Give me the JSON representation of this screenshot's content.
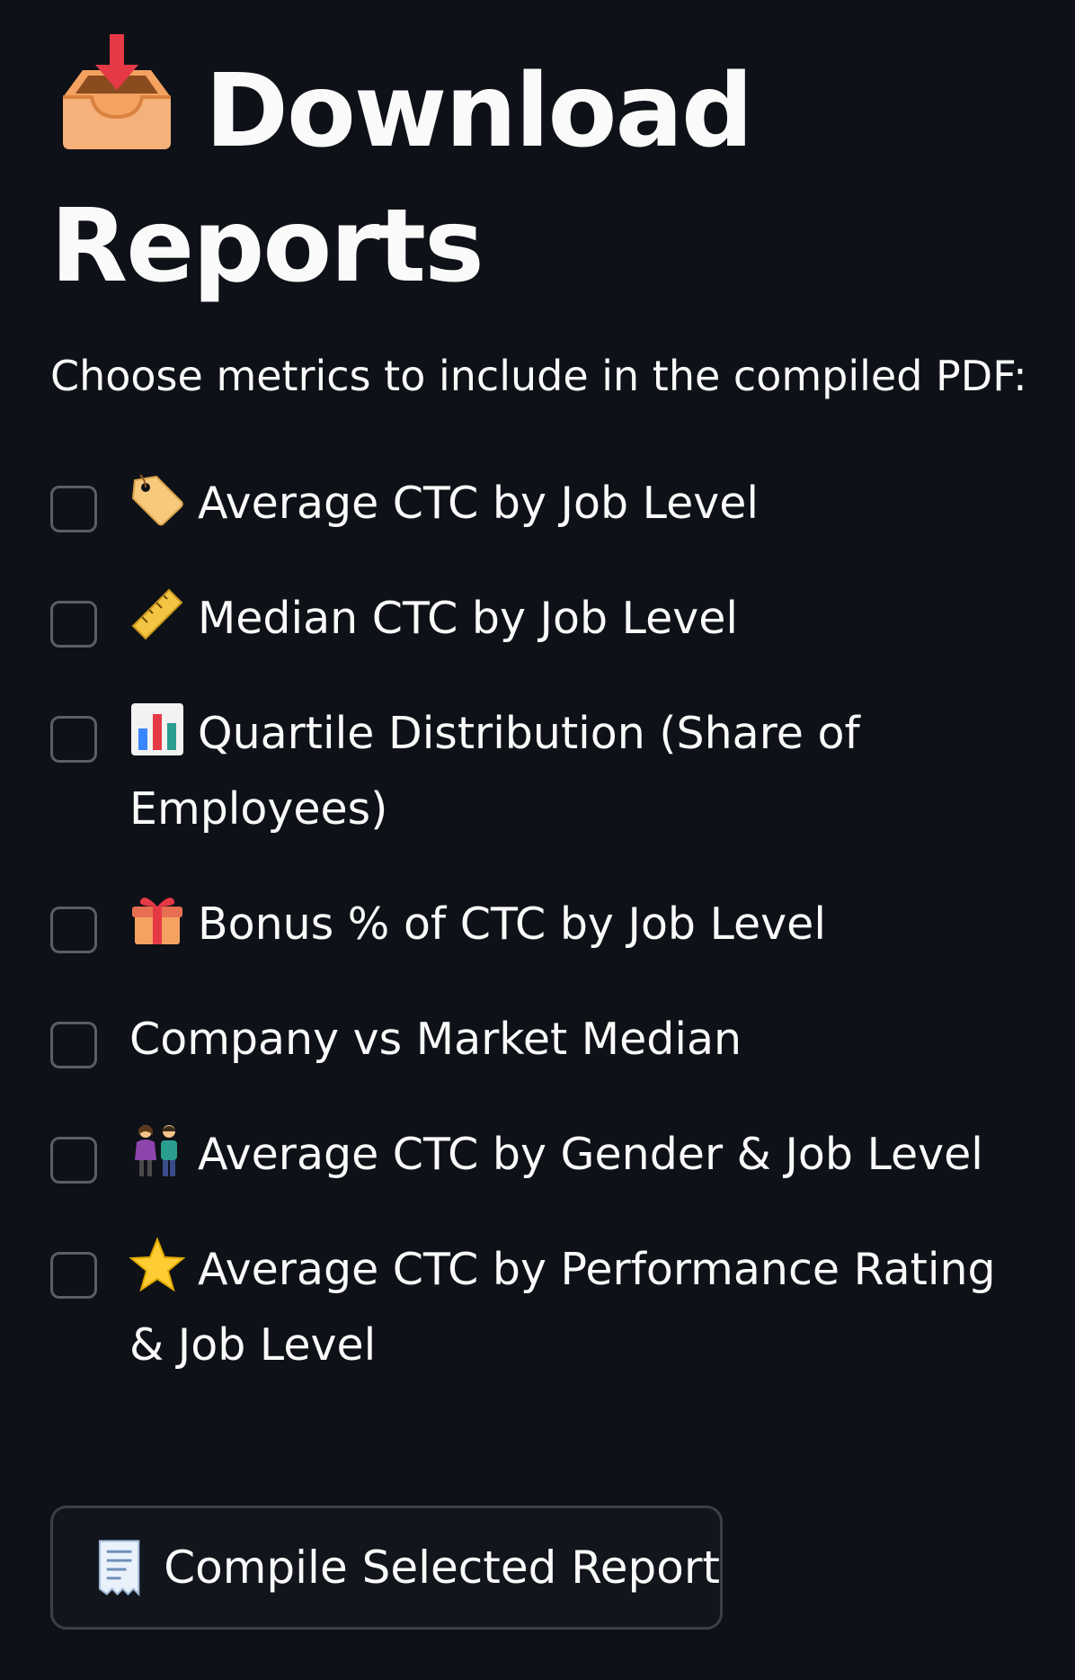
{
  "page": {
    "title": "Download Reports",
    "title_icon": "inbox-tray-icon",
    "subtitle": "Choose metrics to include in the compiled PDF:"
  },
  "options": [
    {
      "label": "Average CTC by Job Level",
      "icon": "label-tag-icon",
      "checked": false
    },
    {
      "label": "Median CTC by Job Level",
      "icon": "ruler-icon",
      "checked": false
    },
    {
      "label": "Quartile Distribution (Share of Employees)",
      "icon": "bar-chart-icon",
      "checked": false
    },
    {
      "label": "Bonus % of CTC by Job Level",
      "icon": "gift-icon",
      "checked": false
    },
    {
      "label": "Company vs Market Median",
      "icon": "",
      "checked": false
    },
    {
      "label": "Average CTC by Gender & Job Level",
      "icon": "man-and-woman-icon",
      "checked": false
    },
    {
      "label": "Average CTC by Performance Rating & Job Level",
      "icon": "star-icon",
      "checked": false
    }
  ],
  "compile_button": {
    "label": "Compile Selected Report",
    "icon": "receipt-icon"
  },
  "colors": {
    "background": "#0e1117",
    "text": "#fafafa",
    "checkbox_border": "#5a5e69",
    "button_border": "#3b3f4a"
  }
}
